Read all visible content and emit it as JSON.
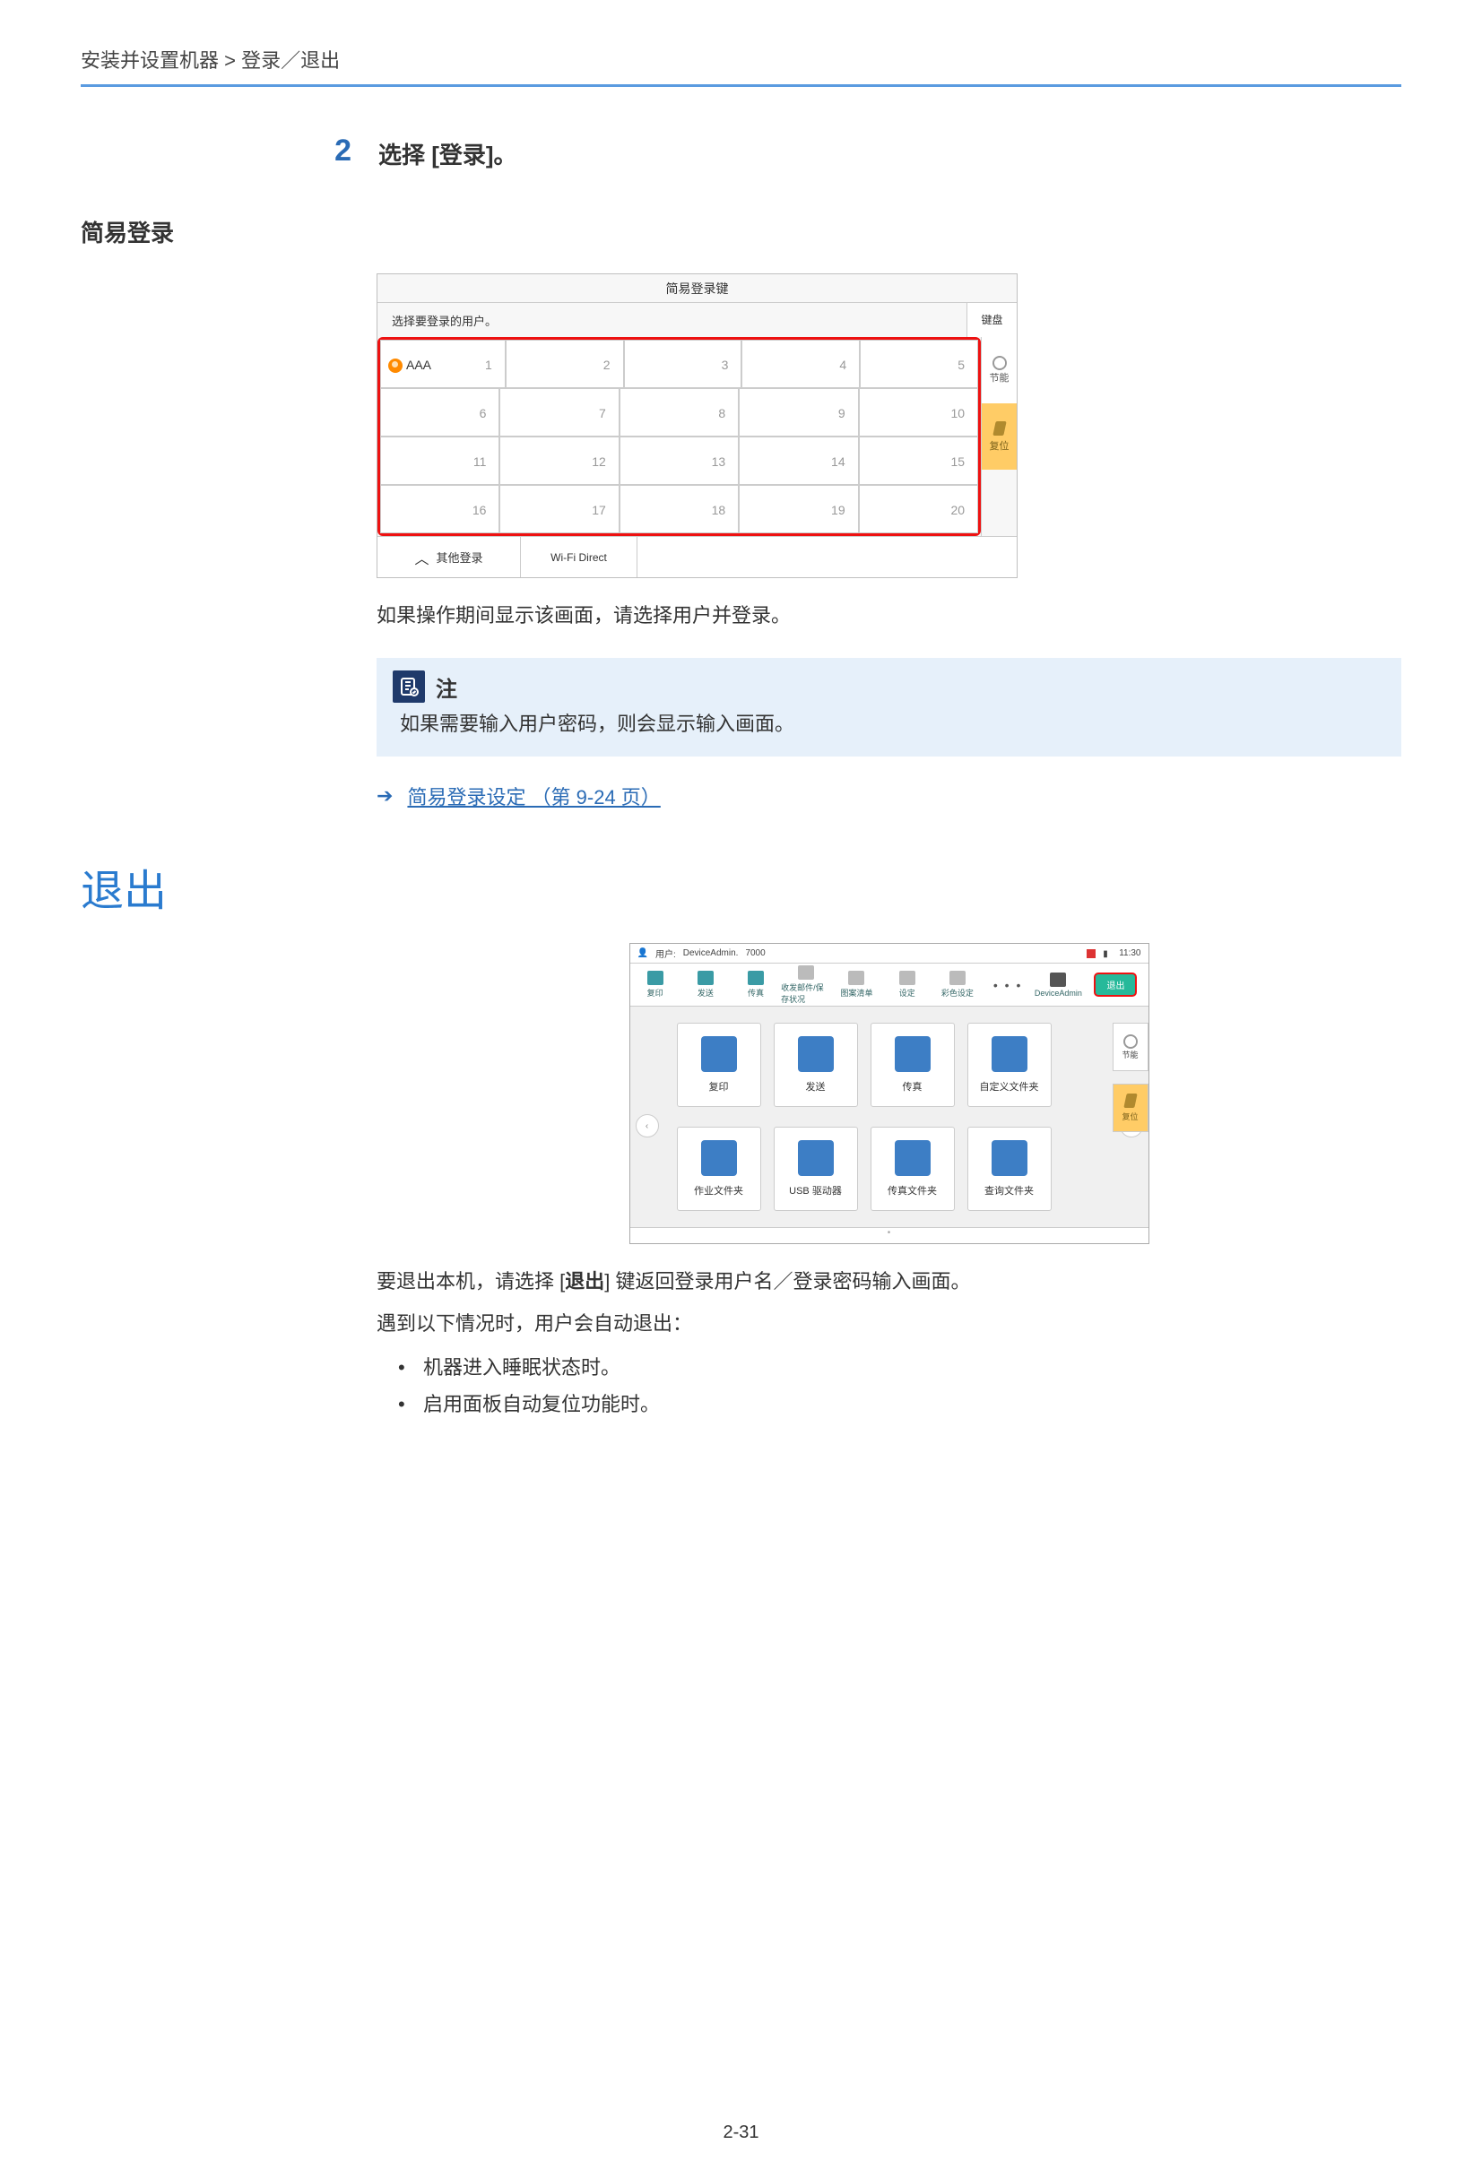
{
  "breadcrumb": "安装并设置机器 > 登录／退出",
  "step": {
    "num": "2",
    "text": "选择 [登录]。"
  },
  "simple_login": {
    "heading": "简易登录",
    "panel": {
      "title": "简易登录键",
      "select_user": "选择要登录的用户。",
      "keypad_btn": "键盘",
      "first_user": "AAA",
      "cells": [
        [
          "1",
          "2",
          "3",
          "4",
          "5"
        ],
        [
          "6",
          "7",
          "8",
          "9",
          "10"
        ],
        [
          "11",
          "12",
          "13",
          "14",
          "15"
        ],
        [
          "16",
          "17",
          "18",
          "19",
          "20"
        ]
      ],
      "side": {
        "energy": "节能",
        "reset": "复位"
      },
      "bottom": {
        "other": "其他登录",
        "wifi": "Wi-Fi Direct"
      }
    },
    "after": "如果操作期间显示该画面，请选择用户并登录。",
    "note": {
      "label": "注",
      "text": "如果需要输入用户密码，则会显示输入画面。"
    },
    "link": "简易登录设定 （第 9-24 页）"
  },
  "logout": {
    "heading": "退出",
    "home": {
      "user_label": "用户:",
      "user_name": "DeviceAdmin.",
      "counter": "7000",
      "time": "11:30",
      "toolbar": [
        "复印",
        "发送",
        "传真",
        "收发邮件/保存状况",
        "图案清单",
        "设定",
        "彩色设定",
        "DeviceAdmin"
      ],
      "dots": "• • •",
      "logout_btn": "退出",
      "apps_row1": [
        "复印",
        "发送",
        "传真",
        "自定义文件夹"
      ],
      "apps_row2": [
        "作业文件夹",
        "USB 驱动器",
        "传真文件夹",
        "查询文件夹"
      ],
      "side": {
        "energy": "节能",
        "reset": "复位"
      }
    },
    "para1a": "要退出本机，请选择 [",
    "para1b": "退出",
    "para1c": "] 键返回登录用户名／登录密码输入画面。",
    "para2": "遇到以下情况时，用户会自动退出：",
    "bullets": [
      "机器进入睡眠状态时。",
      "启用面板自动复位功能时。"
    ]
  },
  "pagenum": "2-31"
}
